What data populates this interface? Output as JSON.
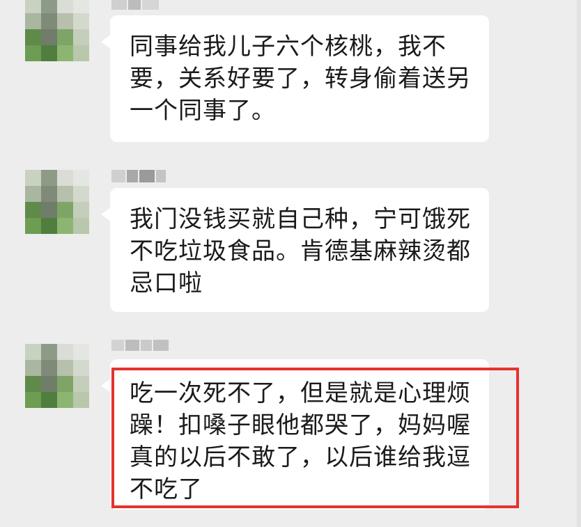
{
  "conversation": {
    "messages": [
      {
        "sender_name": "",
        "text": "同事给我儿子六个核桃，我不要，关系好要了，转身偷着送另一个同事了。"
      },
      {
        "sender_name": "",
        "text": "我门没钱买就自己种，宁可饿死不吃垃圾食品。肯德基麻辣烫都忌口啦"
      },
      {
        "sender_name": "",
        "text": "吃一次死不了，但是就是心理烦躁！扣嗓子眼他都哭了，妈妈喔真的以后不敢了，以后谁给我逗不吃了",
        "highlighted": true
      }
    ]
  },
  "colors": {
    "background": "#ededed",
    "bubble": "#ffffff",
    "highlight_border": "#e5322d",
    "text": "#1a1a1a"
  }
}
